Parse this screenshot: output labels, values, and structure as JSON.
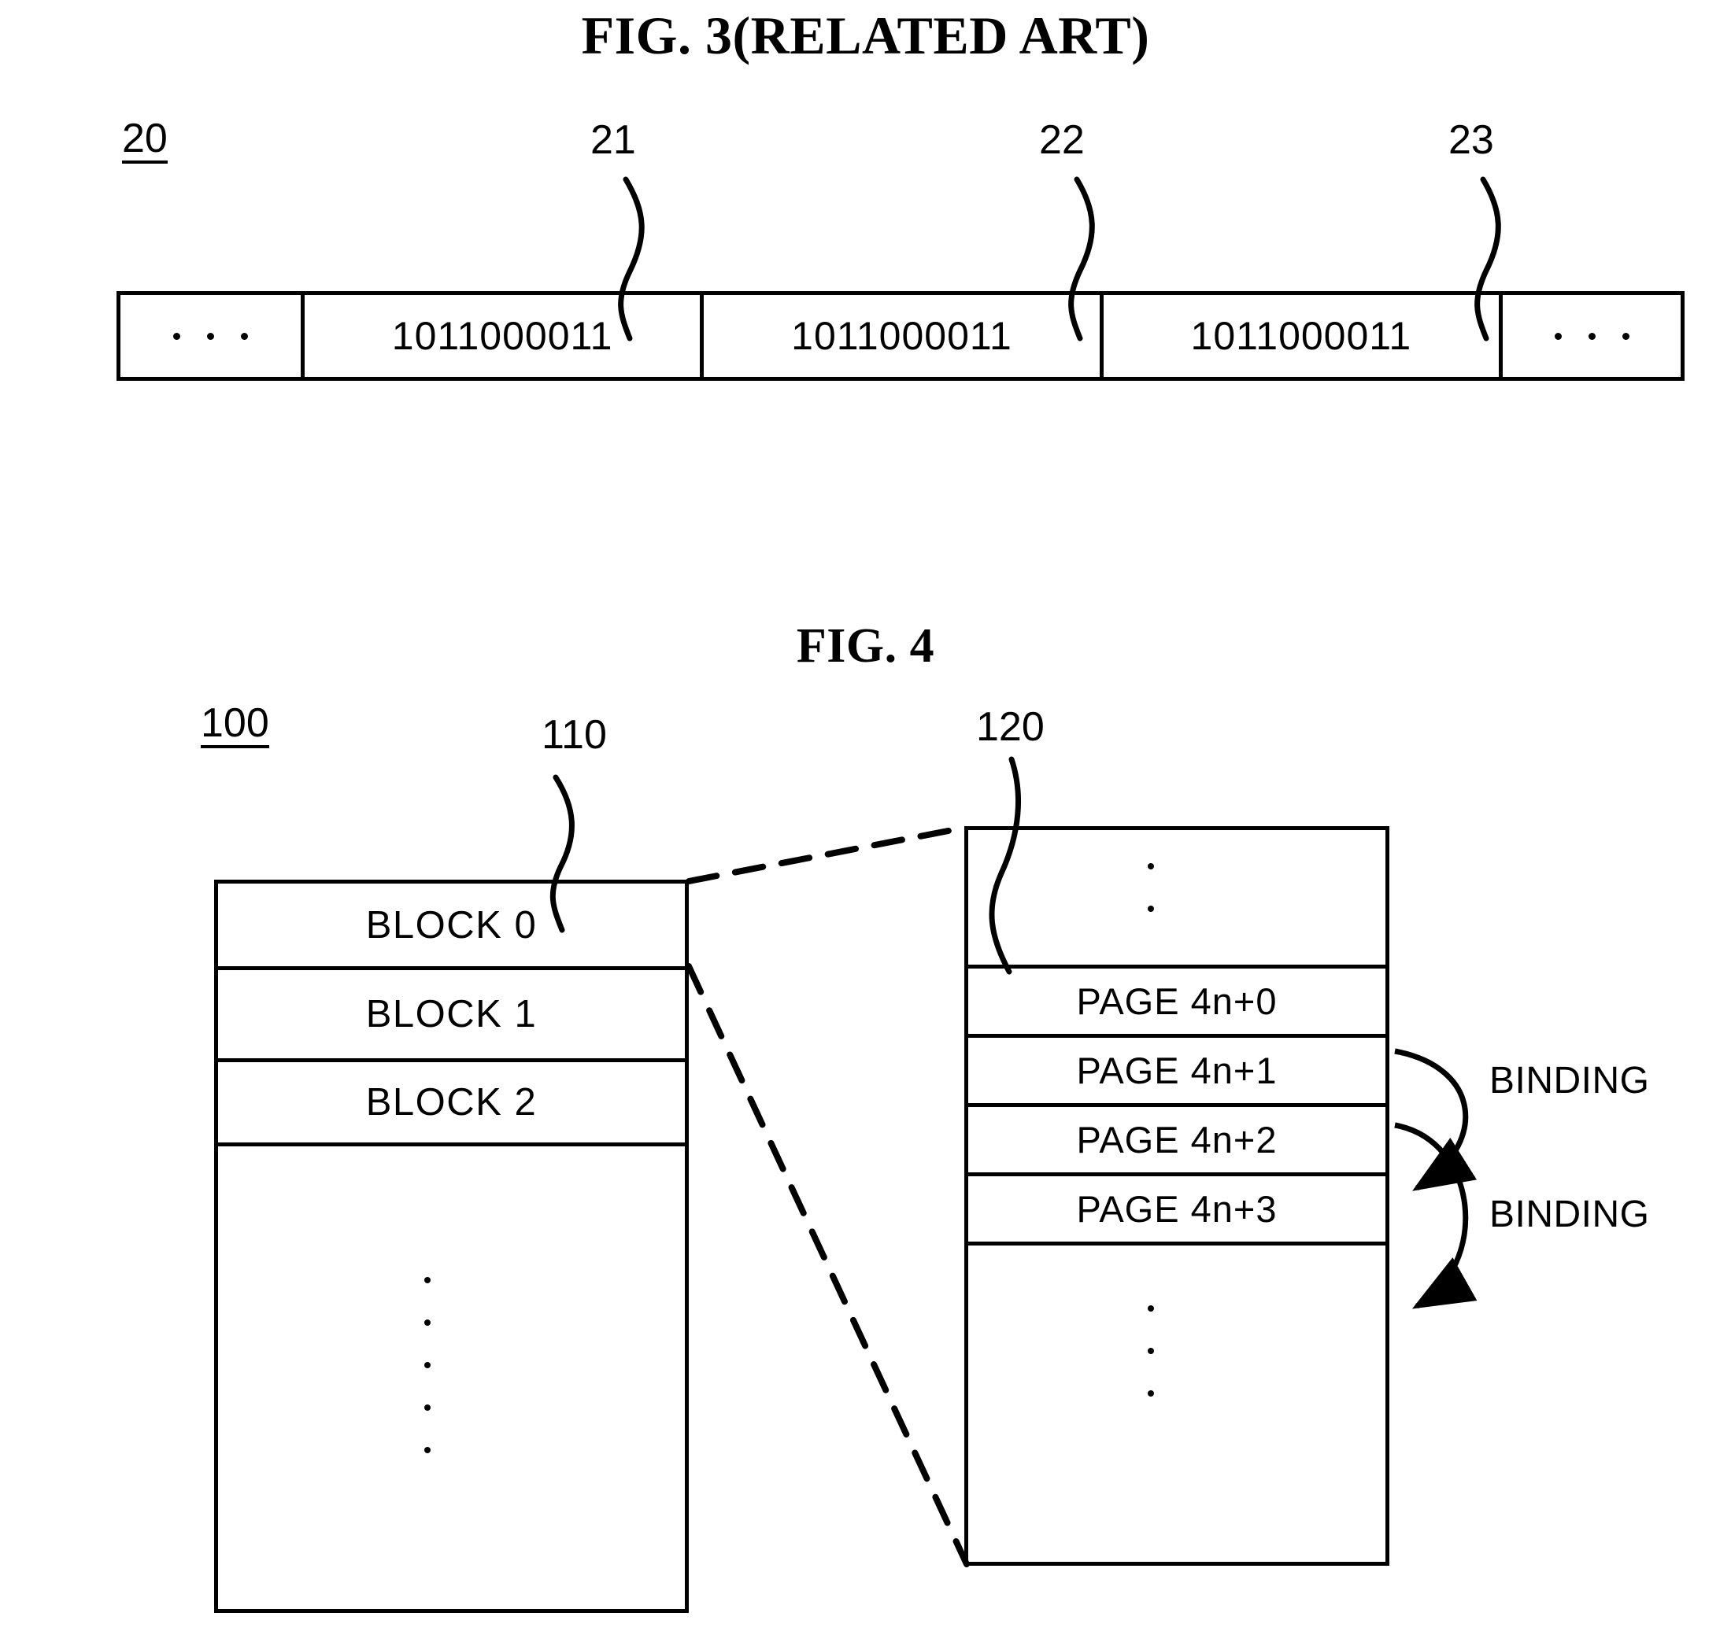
{
  "figures": [
    {
      "title": "FIG. 3(RELATED ART)",
      "ref_main": "20",
      "refs": [
        "21",
        "22",
        "23"
      ],
      "strip": {
        "cells": [
          {
            "kind": "ellipsis",
            "text": "· · ·"
          },
          {
            "kind": "data",
            "text": "1011000011"
          },
          {
            "kind": "data",
            "text": "1011000011"
          },
          {
            "kind": "data",
            "text": "1011000011"
          },
          {
            "kind": "ellipsis",
            "text": "· · ·"
          }
        ]
      }
    },
    {
      "title": "FIG. 4",
      "ref_main": "100",
      "ref_block": "110",
      "ref_page": "120",
      "block_table": {
        "rows": [
          {
            "label": "BLOCK 0"
          },
          {
            "label": "BLOCK 1"
          },
          {
            "label": "BLOCK 2"
          },
          {
            "label": ""
          }
        ]
      },
      "page_table": {
        "rows": [
          {
            "label": ""
          },
          {
            "label": "PAGE 4n+0"
          },
          {
            "label": "PAGE 4n+1"
          },
          {
            "label": "PAGE 4n+2"
          },
          {
            "label": "PAGE 4n+3"
          },
          {
            "label": ""
          }
        ]
      },
      "binding_labels": [
        "BINDING",
        "BINDING"
      ]
    }
  ],
  "colors": {
    "ink": "#000000",
    "paper": "#ffffff"
  }
}
